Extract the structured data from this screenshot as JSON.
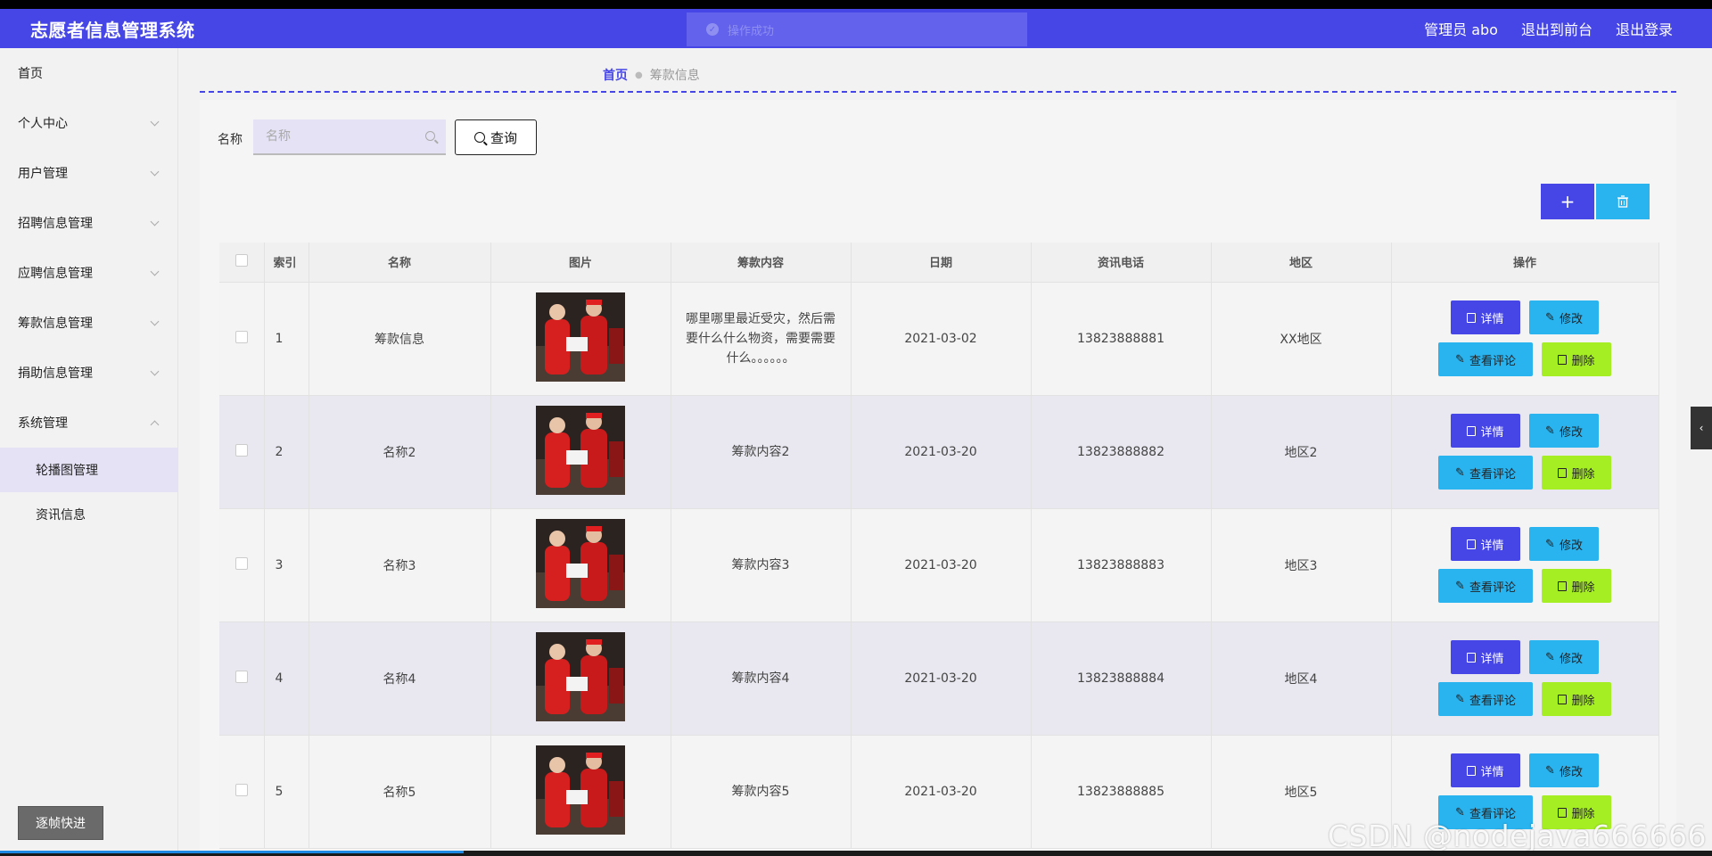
{
  "header": {
    "app_title": "志愿者信息管理系统",
    "toast_text": "操作成功",
    "admin_label": "管理员 abo",
    "to_frontend": "退出到前台",
    "logout": "退出登录"
  },
  "sidebar": {
    "items": [
      {
        "label": "首页"
      },
      {
        "label": "个人中心"
      },
      {
        "label": "用户管理"
      },
      {
        "label": "招聘信息管理"
      },
      {
        "label": "应聘信息管理"
      },
      {
        "label": "筹款信息管理"
      },
      {
        "label": "捐助信息管理"
      },
      {
        "label": "系统管理"
      }
    ],
    "sub_items": [
      {
        "label": "轮播图管理",
        "active": true
      },
      {
        "label": "资讯信息",
        "active": false
      }
    ],
    "bottom_button": "逐帧快进"
  },
  "breadcrumb": {
    "home": "首页",
    "current": "筹款信息"
  },
  "search": {
    "label": "名称",
    "placeholder": "名称",
    "value": "",
    "button": "查询"
  },
  "toolbar": {
    "add_symbol": "+",
    "delete_icon": "trash-icon"
  },
  "table": {
    "headers": [
      "索引",
      "名称",
      "图片",
      "筹款内容",
      "日期",
      "资讯电话",
      "地区",
      "操作"
    ],
    "rows": [
      {
        "index": "1",
        "name": "筹款信息",
        "content": "哪里哪里最近受灾，然后需要什么什么物资，需要需要什么。。。。。。",
        "date": "2021-03-02",
        "phone": "13823888881",
        "region": "XX地区"
      },
      {
        "index": "2",
        "name": "名称2",
        "content": "筹款内容2",
        "date": "2021-03-20",
        "phone": "13823888882",
        "region": "地区2"
      },
      {
        "index": "3",
        "name": "名称3",
        "content": "筹款内容3",
        "date": "2021-03-20",
        "phone": "13823888883",
        "region": "地区3"
      },
      {
        "index": "4",
        "name": "名称4",
        "content": "筹款内容4",
        "date": "2021-03-20",
        "phone": "13823888884",
        "region": "地区4"
      },
      {
        "index": "5",
        "name": "名称5",
        "content": "筹款内容5",
        "date": "2021-03-20",
        "phone": "13823888885",
        "region": "地区5"
      }
    ],
    "actions": {
      "detail": "详情",
      "edit": "修改",
      "comment": "查看评论",
      "delete": "删除"
    }
  },
  "watermark": "CSDN @nodejava666666",
  "colors": {
    "primary": "#4646e6",
    "cyan": "#29b3ef",
    "lime": "#a6ee24"
  }
}
